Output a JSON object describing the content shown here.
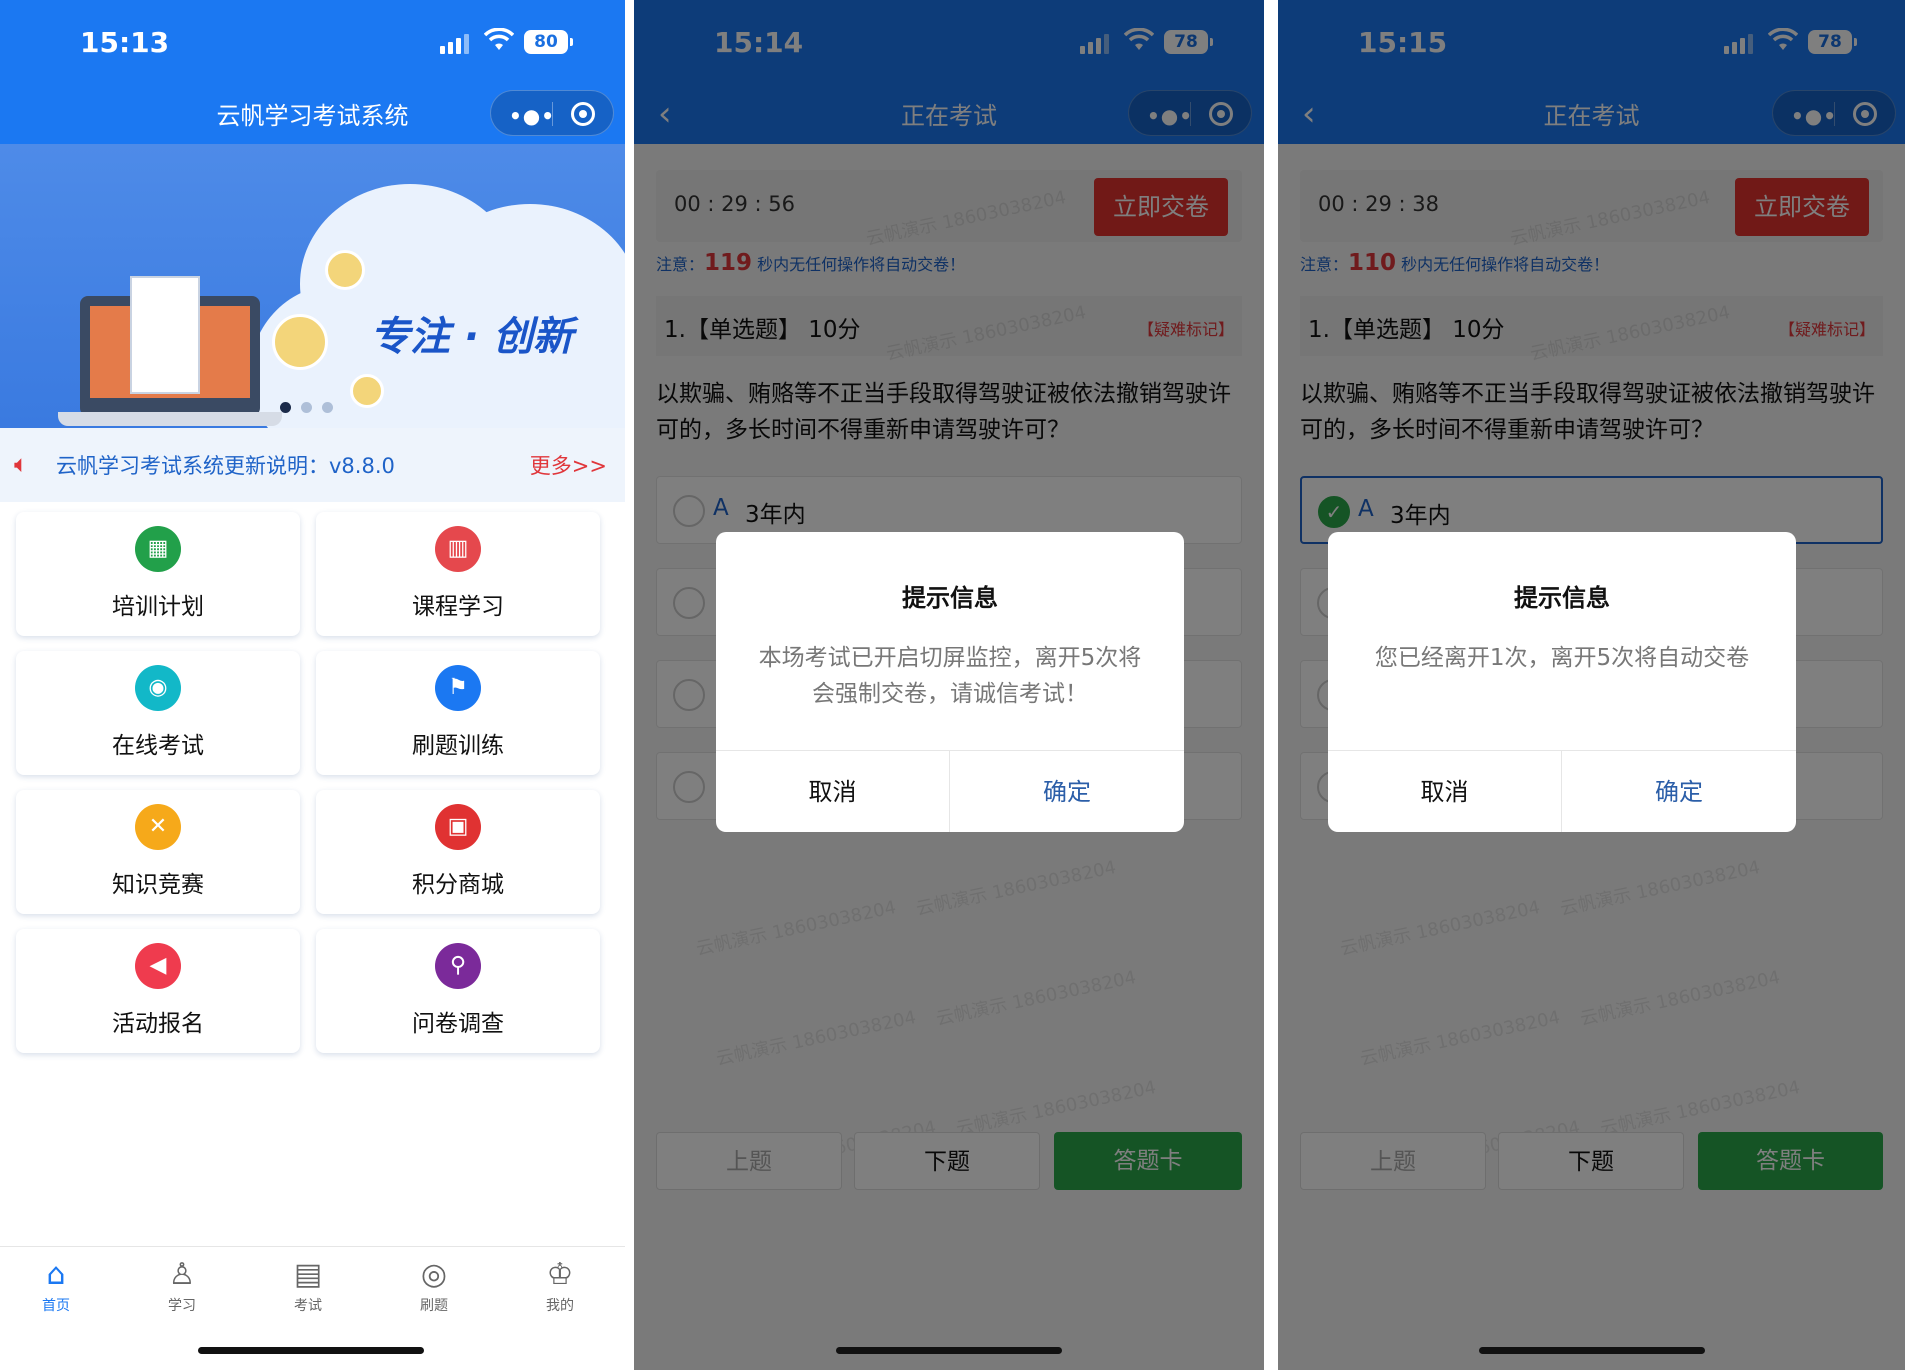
{
  "screen1": {
    "status": {
      "time": "15:13",
      "battery": "80"
    },
    "nav_title": "云帆学习考试系统",
    "banner": {
      "slogan": "专注 · 创新",
      "slides": 3,
      "active_slide": 1
    },
    "notice": {
      "text": "云帆学习考试系统更新说明：v8.8.0",
      "more": "更多>>"
    },
    "menu": [
      {
        "label": "培训计划",
        "icon": "training-plan-icon",
        "color": "#22a04a"
      },
      {
        "label": "课程学习",
        "icon": "books-icon",
        "color": "#e5484d"
      },
      {
        "label": "在线考试",
        "icon": "location-pin-icon",
        "color": "#12b8c8"
      },
      {
        "label": "刷题训练",
        "icon": "flag-icon",
        "color": "#1b78f2"
      },
      {
        "label": "知识竞赛",
        "icon": "swords-icon",
        "color": "#f6a91a"
      },
      {
        "label": "积分商城",
        "icon": "shopping-bag-icon",
        "color": "#e03232"
      },
      {
        "label": "活动报名",
        "icon": "megaphone-icon",
        "color": "#ef3b4e"
      },
      {
        "label": "问卷调查",
        "icon": "survey-search-icon",
        "color": "#7b2a9a"
      }
    ],
    "tabs": [
      {
        "label": "首页",
        "icon": "home-icon",
        "active": true
      },
      {
        "label": "学习",
        "icon": "study-icon",
        "active": false
      },
      {
        "label": "考试",
        "icon": "exam-paper-icon",
        "active": false
      },
      {
        "label": "刷题",
        "icon": "practice-icon",
        "active": false
      },
      {
        "label": "我的",
        "icon": "profile-icon",
        "active": false
      }
    ]
  },
  "screen2": {
    "status": {
      "time": "15:14",
      "battery": "78"
    },
    "nav_title": "正在考试",
    "timer": "00 : 29 : 56",
    "submit": "立即交卷",
    "warn_prefix": "注意：",
    "warn_seconds": "119",
    "warn_suffix": "秒内无任何操作将自动交卷！",
    "question_header": "1.【单选题】 10分",
    "flag": "【疑难标记】",
    "question": "以欺骗、贿赂等不正当手段取得驾驶证被依法撤销驾驶许可的，多长时间不得重新申请驾驶许可？",
    "option_a": {
      "letter": "A",
      "text": "3年内"
    },
    "prev": "上题",
    "next": "下题",
    "answer_card": "答题卡",
    "watermark": "云帆演示 18603038204",
    "dialog": {
      "title": "提示信息",
      "message": "本场考试已开启切屏监控，离开5次将会强制交卷，请诚信考试！",
      "cancel": "取消",
      "confirm": "确定"
    }
  },
  "screen3": {
    "status": {
      "time": "15:15",
      "battery": "78"
    },
    "nav_title": "正在考试",
    "timer": "00 : 29 : 38",
    "submit": "立即交卷",
    "warn_prefix": "注意：",
    "warn_seconds": "110",
    "warn_suffix": "秒内无任何操作将自动交卷！",
    "question_header": "1.【单选题】 10分",
    "flag": "【疑难标记】",
    "question": "以欺骗、贿赂等不正当手段取得驾驶证被依法撤销驾驶许可的，多长时间不得重新申请驾驶许可？",
    "option_a": {
      "letter": "A",
      "text": "3年内"
    },
    "prev": "上题",
    "next": "下题",
    "answer_card": "答题卡",
    "watermark": "云帆演示 18603038204",
    "dialog": {
      "title": "提示信息",
      "message": "您已经离开1次，离开5次将自动交卷",
      "cancel": "取消",
      "confirm": "确定"
    }
  }
}
